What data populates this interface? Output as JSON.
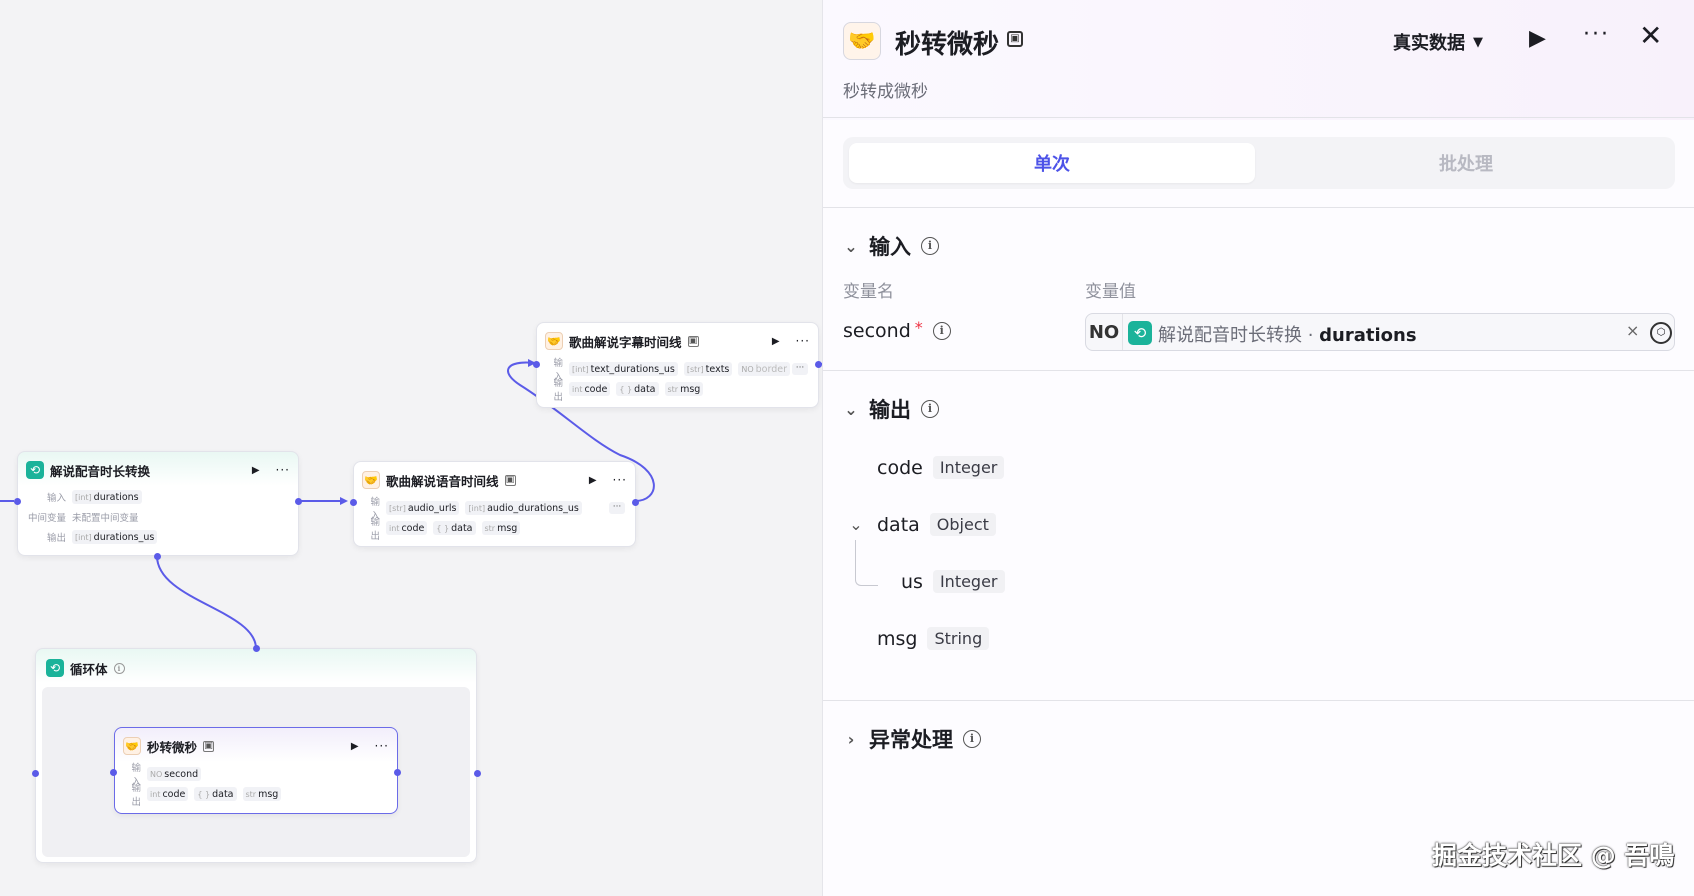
{
  "canvas": {
    "nodes": [
      {
        "id": "loop-convert",
        "title": "解说配音时长转换",
        "rows": [
          {
            "label": "输入",
            "tags": [
              {
                "type": "[int]",
                "text": "durations"
              }
            ]
          },
          {
            "label": "中间变量",
            "plain": "未配置中间变量"
          },
          {
            "label": "输出",
            "tags": [
              {
                "type": "[int]",
                "text": "durations_us"
              }
            ]
          }
        ]
      },
      {
        "id": "voice-timeline",
        "title": "歌曲解说语音时间线",
        "rows": [
          {
            "label": "输入",
            "tags": [
              {
                "type": "[str]",
                "text": "audio_urls"
              },
              {
                "type": "[int]",
                "text": "audio_durations_us"
              }
            ]
          },
          {
            "label": "输出",
            "tags": [
              {
                "type": "int",
                "text": "code"
              },
              {
                "type": "{ }",
                "text": "data"
              },
              {
                "type": "str",
                "text": "msg"
              }
            ]
          }
        ]
      },
      {
        "id": "subtitle-timeline",
        "title": "歌曲解说字幕时间线",
        "rows": [
          {
            "label": "输入",
            "tags": [
              {
                "type": "[int]",
                "text": "text_durations_us"
              },
              {
                "type": "[str]",
                "text": "texts"
              },
              {
                "type": "NO",
                "text": "border"
              }
            ]
          },
          {
            "label": "输出",
            "tags": [
              {
                "type": "int",
                "text": "code"
              },
              {
                "type": "{ }",
                "text": "data"
              },
              {
                "type": "str",
                "text": "msg"
              }
            ]
          }
        ]
      },
      {
        "id": "loop-body",
        "title": "循环体"
      },
      {
        "id": "sec-to-us",
        "title": "秒转微秒",
        "rows": [
          {
            "label": "输入",
            "tags": [
              {
                "type": "NO",
                "text": "second"
              }
            ]
          },
          {
            "label": "输出",
            "tags": [
              {
                "type": "int",
                "text": "code"
              },
              {
                "type": "{ }",
                "text": "data"
              },
              {
                "type": "str",
                "text": "msg"
              }
            ]
          }
        ]
      }
    ]
  },
  "panel": {
    "title": "秒转微秒",
    "description": "秒转成微秒",
    "data_selector": "真实数据",
    "tabs": [
      "单次",
      "批处理"
    ],
    "input_section": {
      "title": "输入",
      "col_name": "变量名",
      "col_value": "变量值",
      "param": {
        "name": "second",
        "required": "*",
        "type_icon": "NO",
        "ref_node": "解说配音时长转换",
        "ref_sep": " · ",
        "ref_var": "durations"
      }
    },
    "output_section": {
      "title": "输出",
      "fields": [
        {
          "name": "code",
          "type": "Integer"
        },
        {
          "name": "data",
          "type": "Object"
        },
        {
          "name": "us",
          "type": "Integer"
        },
        {
          "name": "msg",
          "type": "String"
        }
      ]
    },
    "error_section": {
      "title": "异常处理"
    }
  },
  "watermark": "掘金技术社区 @ 吾鳴",
  "colors": {
    "accent": "#4d53e8",
    "edge": "#5b5be8",
    "teal": "#1bb39a"
  }
}
